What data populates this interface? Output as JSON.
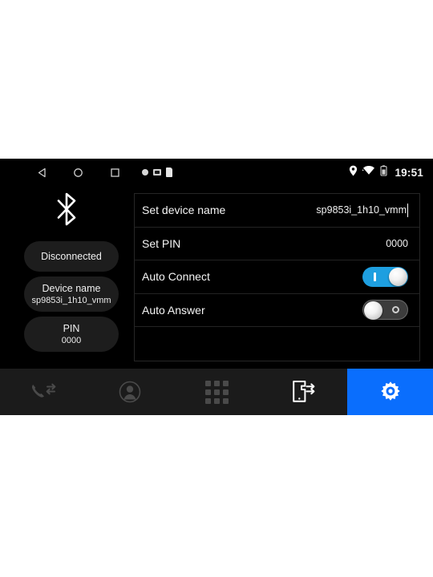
{
  "statusbar": {
    "back_icon": "triangle-back-icon",
    "home_icon": "circle-home-icon",
    "recents_icon": "square-recents-icon",
    "left_icons": [
      "dot-indicator-icon",
      "sd-card-icon",
      "sim-card-icon"
    ],
    "right_icons": [
      "location-pin-icon",
      "wifi-icon",
      "battery-icon"
    ],
    "time": "19:51"
  },
  "left_panel": {
    "bluetooth_icon": "bluetooth-icon",
    "status_pill": {
      "label": "Disconnected"
    },
    "device_pill": {
      "title": "Device name",
      "value": "sp9853i_1h10_vmm"
    },
    "pin_pill": {
      "title": "PIN",
      "value": "0000"
    }
  },
  "settings": {
    "rows": [
      {
        "label": "Set device name",
        "value": "sp9853i_1h10_vmm",
        "type": "text"
      },
      {
        "label": "Set PIN",
        "value": "0000",
        "type": "text"
      },
      {
        "label": "Auto Connect",
        "value": "on",
        "type": "toggle"
      },
      {
        "label": "Auto Answer",
        "value": "off",
        "type": "toggle"
      }
    ]
  },
  "tabbar": {
    "items": [
      {
        "name": "call-history-icon",
        "label": "Call history",
        "active": false
      },
      {
        "name": "contacts-icon",
        "label": "Contacts",
        "active": false
      },
      {
        "name": "dialpad-icon",
        "label": "Dial pad",
        "active": false
      },
      {
        "name": "device-sync-icon",
        "label": "Sync device",
        "active": false
      },
      {
        "name": "settings-gear-icon",
        "label": "Settings",
        "active": true
      }
    ],
    "active_color": "#0a6efd"
  },
  "colors": {
    "background": "#000000",
    "panel_border": "#262626",
    "pill_bg": "#1d1d1d",
    "tabbar_bg": "#1b1b1b",
    "toggle_on": "#1e9fe0",
    "toggle_off": "#3c3c3c",
    "accent_blue": "#0a6efd",
    "text_primary": "#f5f5f5"
  }
}
